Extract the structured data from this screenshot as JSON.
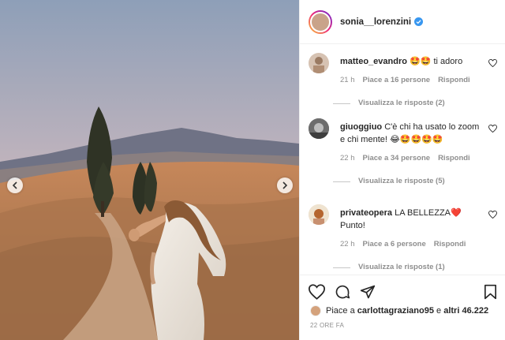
{
  "post": {
    "username": "sonia__lorenzini",
    "likes_prefix": "Piace a ",
    "likes_user": "carlottagraziano95",
    "likes_mid": " e ",
    "likes_others": "altri 46.222",
    "time_ago": "22 ORE FA"
  },
  "comments": [
    {
      "user": "matteo_evandro",
      "text": "🤩🤩 ti adoro",
      "time": "21 h",
      "likes": "Piace a 16 persone",
      "reply": "Rispondi",
      "view_replies": "Visualizza le risposte (2)"
    },
    {
      "user": "giuoggiuo",
      "text": "C'è chi ha usato lo zoom e chi mente! 😂🤩🤩🤩🤩",
      "time": "22 h",
      "likes": "Piace a 34 persone",
      "reply": "Rispondi",
      "view_replies": "Visualizza le risposte (5)"
    },
    {
      "user": "privateopera",
      "text": "LA BELLEZZA❤️ Punto!",
      "time": "22 h",
      "likes": "Piace a 6 persone",
      "reply": "Rispondi",
      "view_replies": "Visualizza le risposte (1)"
    }
  ],
  "icons": {
    "verified": "verified-badge-icon",
    "like": "heart-icon",
    "comment": "comment-bubble-icon",
    "share": "paper-plane-icon",
    "save": "bookmark-icon",
    "prev": "chevron-left-icon",
    "next": "chevron-right-icon"
  },
  "colors": {
    "verified_blue": "#3897f0",
    "muted": "#8e8e8e",
    "text": "#262626"
  }
}
